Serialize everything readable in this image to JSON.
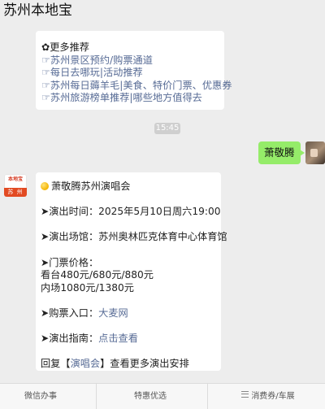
{
  "header": {
    "title": "苏州本地宝",
    "more_icon": "ellipsis-icon"
  },
  "message1": {
    "lines": [
      "✿更多推荐",
      "☞苏州景区预约/购票通道",
      "☞每日去哪玩|活动推荐",
      "☞苏州每日薅羊毛|美食、特价门票、优惠券",
      "☞苏州旅游榜单推荐|哪些地方值得去"
    ]
  },
  "timestamp": "15:45",
  "user_message": {
    "text": "萧敬腾"
  },
  "bot_avatar": {
    "top_text": "本地宝",
    "bottom_text": "苏 州"
  },
  "message2": {
    "title": "萧敬腾苏州演唱会",
    "time_line": "➤演出时间：2025年5月10日周六19:00",
    "venue_line": "➤演出场馆：苏州奥林匹克体育中心体育馆",
    "price_label": "➤门票价格：",
    "price_line1": "看台480元/680元/880元",
    "price_line2": "内场1080元/1380元",
    "ticket_prefix": "➤购票入口：",
    "ticket_link": "大麦网",
    "guide_prefix": "➤演出指南：",
    "guide_link": "点击查看",
    "reply_prefix": "回复【",
    "reply_link": "演唱会",
    "reply_suffix": "】查看更多演出安排"
  },
  "bottom_menu": {
    "items": [
      "微信办事",
      "特惠优选",
      "消费券/车展"
    ]
  },
  "colors": {
    "link": "#576b95",
    "bubble_green": "#95ec69",
    "background": "#ededed"
  }
}
